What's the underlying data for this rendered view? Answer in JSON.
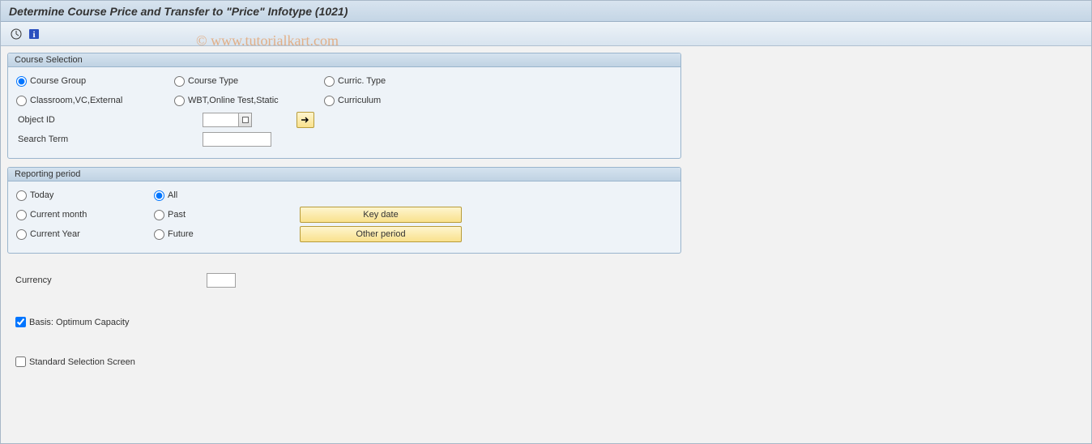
{
  "title": "Determine Course Price and Transfer to \"Price\" Infotype (1021)",
  "watermark": "© www.tutorialkart.com",
  "course_selection": {
    "header": "Course Selection",
    "r1": {
      "a": "Course Group",
      "b": "Course Type",
      "c": "Curric. Type"
    },
    "r2": {
      "a": "Classroom,VC,External",
      "b": "WBT,Online Test,Static",
      "c": "Curriculum"
    },
    "object_id_label": "Object ID",
    "object_id_value": "",
    "search_term_label": "Search Term",
    "search_term_value": ""
  },
  "reporting_period": {
    "header": "Reporting period",
    "r1": {
      "a": "Today",
      "b": "All"
    },
    "r2": {
      "a": "Current month",
      "b": "Past",
      "btn": "Key date"
    },
    "r3": {
      "a": "Current Year",
      "b": "Future",
      "btn": "Other period"
    }
  },
  "currency": {
    "label": "Currency",
    "value": ""
  },
  "basis": {
    "label": "Basis: Optimum Capacity",
    "checked": true
  },
  "std_sel": {
    "label": "Standard Selection Screen",
    "checked": false
  }
}
